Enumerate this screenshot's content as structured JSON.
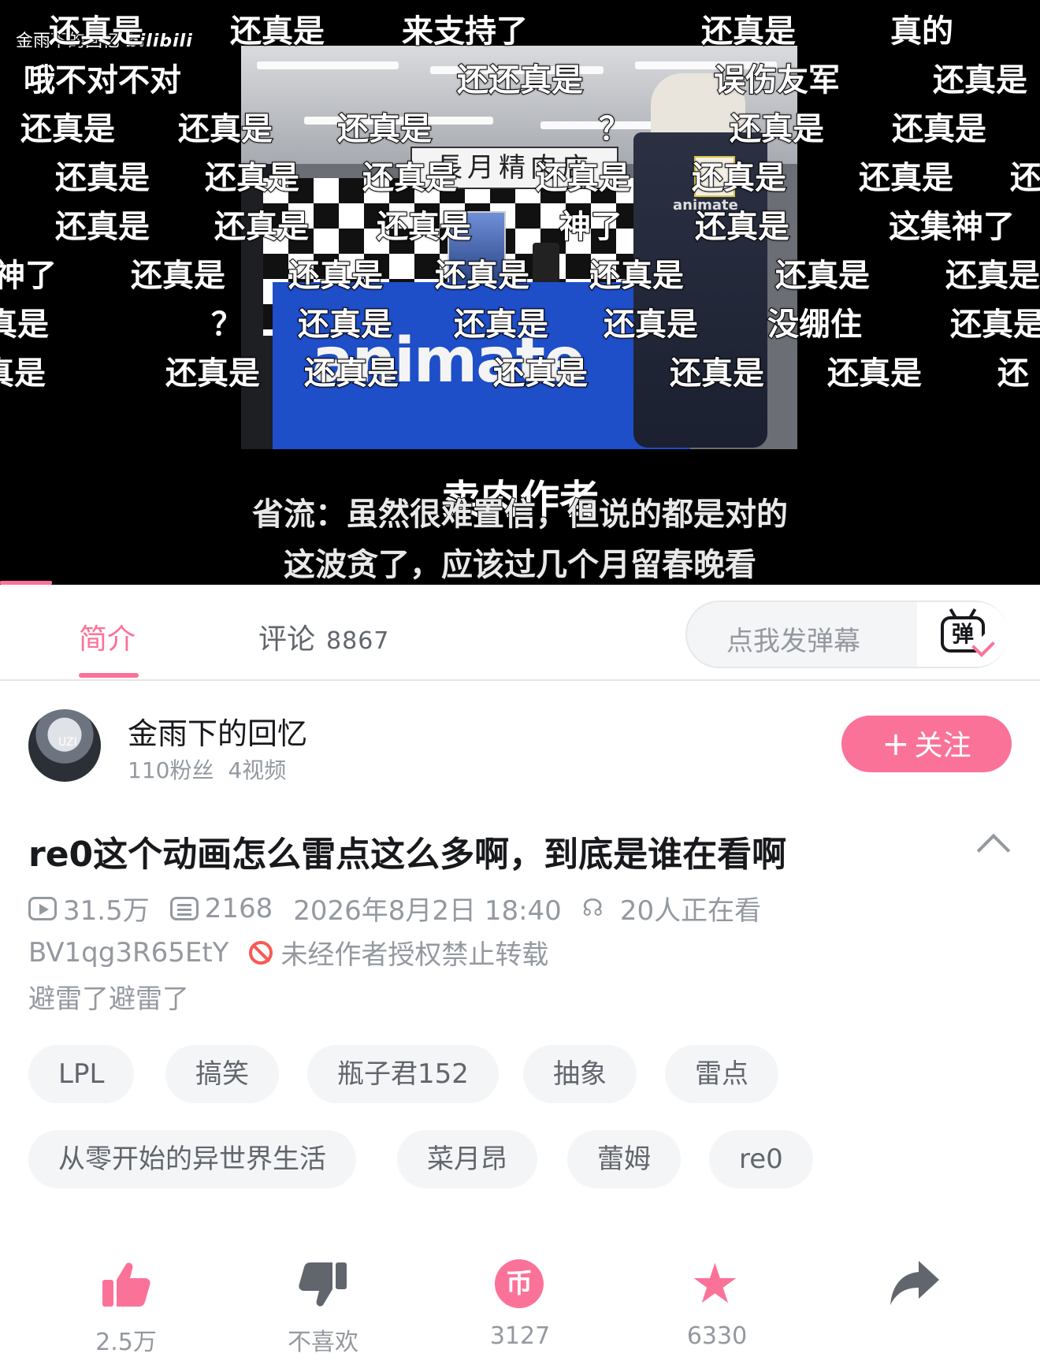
{
  "player": {
    "uploader_watermark": "金雨下的回忆",
    "logo_text": "bilibili",
    "frame_sign": "長月精肉店",
    "frame_brand": "animate",
    "apron_brand": "animate",
    "danmaku": [
      "还真是",
      "还真是",
      "来支持了",
      "还真是",
      "真的",
      "哦不对不对",
      "还还真是",
      "误伤友军",
      "还真是",
      "还真是",
      "还真是",
      "还真是",
      "？",
      "还真是",
      "还真是",
      "还真是",
      "还真是",
      "还真是",
      "还真是",
      "还真是",
      "还真是",
      "还",
      "还真是",
      "还真是",
      "还真是",
      "神了",
      "还真是",
      "这集神了",
      "神了",
      "还真是",
      "还真是",
      "还真是",
      "还真是",
      "还真是",
      "还真是",
      "真是",
      "？",
      "还真是",
      "还真是",
      "还真是",
      "没绷住",
      "还真是",
      "真是",
      "还真是",
      "还真是",
      "还真是",
      "还真是",
      "还真是",
      "还"
    ],
    "subtitle_main": "卖肉作者",
    "subtitle_line1": "省流：虽然很难置信，但说的都是对的",
    "subtitle_line2": "这波贪了，应该过几个月留春晚看",
    "progress": 0.05
  },
  "tabs": {
    "intro": "简介",
    "comments": "评论",
    "comments_count": "8867",
    "danmaku_placeholder": "点我发弹幕",
    "danmaku_toggle_glyph": "弹"
  },
  "uploader": {
    "name": "金雨下的回忆",
    "followers": "110粉丝",
    "videos": "4视频",
    "follow_label": "关注",
    "follow_plus": "+"
  },
  "video": {
    "title": "re0这个动画怎么雷点这么多啊，到底是谁在看啊",
    "views": "31.5万",
    "danmaku_count": "2168",
    "publish_time": "2026年8月2日 18:40",
    "watching": "20人正在看",
    "bvid": "BV1qg3R65EtY",
    "copyright": "未经作者授权禁止转载",
    "description": "避雷了避雷了"
  },
  "tags": [
    "LPL",
    "搞笑",
    "瓶子君152",
    "抽象",
    "雷点",
    "从零开始的异世界生活",
    "菜月昂",
    "蕾姆",
    "re0"
  ],
  "actions": {
    "like": "2.5万",
    "dislike": "不喜欢",
    "coin": "3127",
    "coin_glyph": "币",
    "favorite": "6330",
    "share": ""
  },
  "colors": {
    "accent": "#fb7299",
    "text_primary": "#18191c",
    "text_secondary": "#9499a0",
    "warning": "#f85a54"
  },
  "icons": [
    "play-count-icon",
    "danmaku-count-icon",
    "watching-icon",
    "no-repost-icon",
    "like-icon",
    "dislike-icon",
    "coin-icon",
    "favorite-icon",
    "share-icon",
    "collapse-chevron-icon",
    "danmaku-toggle-icon"
  ]
}
